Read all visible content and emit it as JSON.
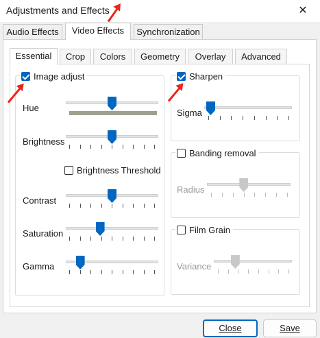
{
  "window": {
    "title": "Adjustments and Effects",
    "close_glyph": "✕"
  },
  "tabs": [
    "Audio Effects",
    "Video Effects",
    "Synchronization"
  ],
  "active_tab": "Video Effects",
  "subtabs": [
    "Essential",
    "Crop",
    "Colors",
    "Geometry",
    "Overlay",
    "Advanced"
  ],
  "active_subtab": "Essential",
  "image_adjust": {
    "label": "Image adjust",
    "checked": true,
    "sliders": [
      {
        "label": "Hue",
        "value": 0.5
      },
      {
        "label": "Brightness",
        "value": 0.5
      },
      {
        "label": "Contrast",
        "value": 0.5
      },
      {
        "label": "Saturation",
        "value": 0.35
      },
      {
        "label": "Gamma",
        "value": 0.1
      }
    ],
    "brightness_threshold": {
      "label": "Brightness Threshold",
      "checked": false
    }
  },
  "sharpen": {
    "label": "Sharpen",
    "checked": true,
    "slider_label": "Sigma",
    "value": 0.0
  },
  "banding_removal": {
    "label": "Banding removal",
    "checked": false,
    "slider_label": "Radius",
    "value": 0.43
  },
  "film_grain": {
    "label": "Film Grain",
    "checked": false,
    "slider_label": "Variance",
    "value": 0.23
  },
  "buttons": {
    "close": "Close",
    "save": "Save"
  },
  "colors": {
    "accent": "#0067c0",
    "annotation_arrow": "#e8261a"
  }
}
